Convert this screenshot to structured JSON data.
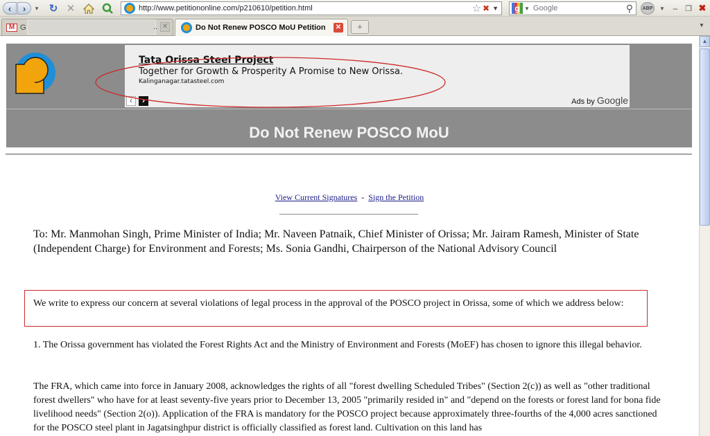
{
  "browser": {
    "url": "http://www.petitiononline.com/p210610/petition.html",
    "search_placeholder": "Google",
    "abp_label": "ABP",
    "tabs": [
      {
        "title": "G",
        "icon": "gmail-icon"
      },
      {
        "title": "Do Not Renew POSCO MoU Petition",
        "icon": "petitiononline-favicon"
      }
    ],
    "icons": {
      "back": "back-arrow-icon",
      "forward": "forward-arrow-icon",
      "reload": "reload-icon",
      "stop": "stop-icon",
      "home": "home-icon",
      "bookmark": "star-icon",
      "search": "magnifier-icon"
    }
  },
  "ad": {
    "title": "Tata Orissa Steel Project",
    "tagline": "Together for Growth & Prosperity A Promise to New Orissa.",
    "url": "Kalinganagar.tatasteel.com",
    "ads_by": "Ads by",
    "ads_brand": "Google"
  },
  "page": {
    "title": "Do Not Renew POSCO MoU",
    "links": {
      "view_signatures": "View Current Signatures",
      "separator": "-",
      "sign": "Sign the Petition"
    },
    "to_line": "To:  Mr. Manmohan Singh, Prime Minister of India; Mr. Naveen Patnaik, Chief Minister of Orissa; Mr. Jairam Ramesh, Minister of State (Independent Charge) for Environment and Forests; Ms. Sonia Gandhi, Chairperson of the National Advisory Council",
    "concern": "We write to express our concern at several violations of legal process in the approval of the POSCO project in Orissa, some of which we address below:",
    "para1": "1. The Orissa government has violated the Forest Rights Act and the Ministry of Environment and Forests (MoEF) has chosen to ignore this illegal behavior.",
    "para2": "The FRA, which came into force in January 2008, acknowledges the rights of all \"forest dwelling Scheduled Tribes\" (Section 2(c)) as well as \"other traditional forest dwellers\" who have for at least seventy-five years prior to December 13, 2005 \"primarily resided in\" and \"depend on the forests or forest land for bona fide livelihood needs\" (Section 2(o)). Application of the FRA is mandatory for the POSCO project because approximately three-fourths of the 4,000 acres sanctioned for the POSCO steel plant in Jagatsinghpur district is officially classified as forest land. Cultivation on this land has"
  },
  "colors": {
    "header_band": "#8c8c8c",
    "annotation_red": "#cc2a2a",
    "link_blue": "#1a1a8a",
    "logo_blue": "#1f8fd8",
    "logo_yellow": "#f2a40c"
  }
}
